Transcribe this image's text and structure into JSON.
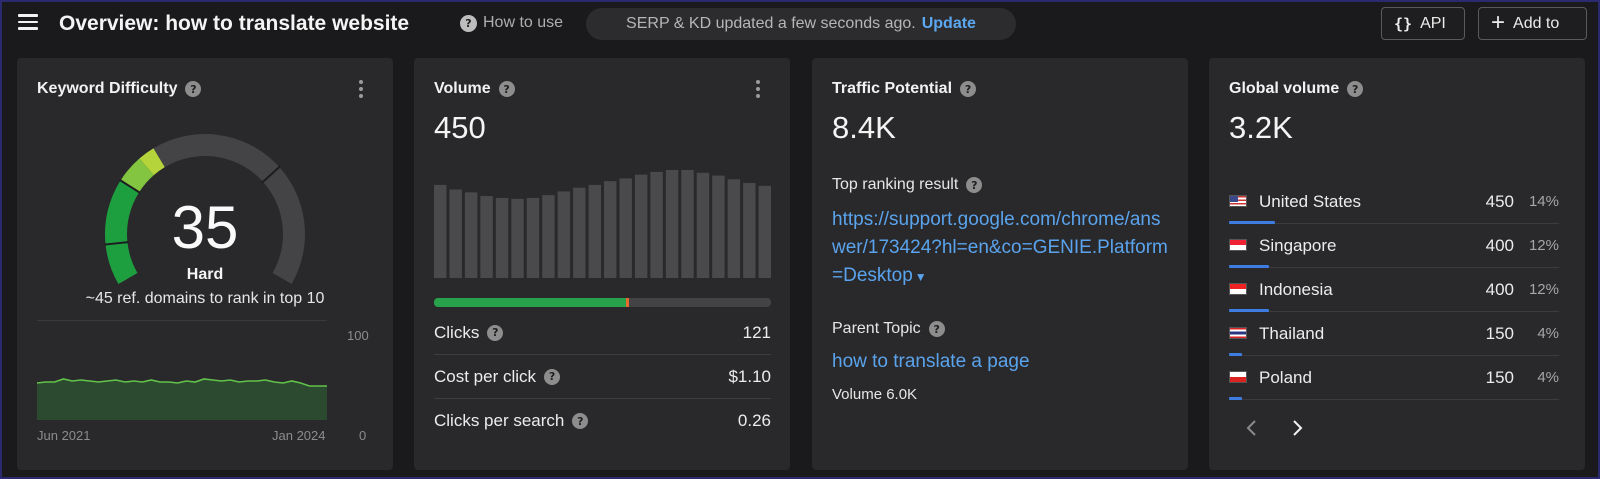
{
  "header": {
    "title": "Overview: how to translate website",
    "how_to_use": "How to use",
    "serp_status": "SERP & KD updated a few seconds ago.",
    "update_label": "Update",
    "api_icon": "{}",
    "api_label": "API",
    "add_label": "Add to"
  },
  "kd": {
    "title": "Keyword Difficulty",
    "value": 35,
    "value_text": "35",
    "level": "Hard",
    "note": "~45 ref. domains to rank in top 10",
    "chart": {
      "type": "area",
      "x_start": "Jun 2021",
      "x_end": "Jan 2024",
      "y_max": "100",
      "y_min": "0",
      "values": [
        37,
        38,
        38,
        41,
        39,
        40,
        39,
        38,
        39,
        40,
        38,
        39,
        38,
        40,
        38,
        38,
        37,
        39,
        38,
        41,
        40,
        39,
        40,
        38,
        39,
        39,
        40,
        38,
        37,
        39,
        37,
        34,
        34,
        34
      ]
    },
    "colors": {
      "easy": "#1e9f3f",
      "medium": "#83c440",
      "marker": "#b5d33a",
      "track": "#444446"
    }
  },
  "volume": {
    "title": "Volume",
    "value": "450",
    "bars": [
      100,
      95,
      92,
      88,
      86,
      85,
      86,
      89,
      93,
      97,
      100,
      104,
      107,
      111,
      114,
      116,
      116,
      113,
      110,
      106,
      102,
      99
    ],
    "clicks_share": 0.57,
    "metrics": [
      {
        "label": "Clicks",
        "value": "121"
      },
      {
        "label": "Cost per click",
        "value": "$1.10"
      },
      {
        "label": "Clicks per search",
        "value": "0.26"
      }
    ]
  },
  "traffic": {
    "title": "Traffic Potential",
    "value": "8.4K",
    "top_ranking_label": "Top ranking result",
    "top_ranking_url": "https://support.google.com/chrome/answer/173424?hl=en&co=GENIE.Platform=Desktop",
    "parent_topic_label": "Parent Topic",
    "parent_topic": "how to translate a page",
    "parent_volume": "Volume 6.0K"
  },
  "global": {
    "title": "Global volume",
    "value": "3.2K",
    "countries": [
      {
        "name": "United States",
        "volume": "450",
        "pct": "14%",
        "share": 0.14,
        "flag": "us-flag"
      },
      {
        "name": "Singapore",
        "volume": "400",
        "pct": "12%",
        "share": 0.12,
        "flag": "sg-flag"
      },
      {
        "name": "Indonesia",
        "volume": "400",
        "pct": "12%",
        "share": 0.12,
        "flag": "id-flag"
      },
      {
        "name": "Thailand",
        "volume": "150",
        "pct": "4%",
        "share": 0.04,
        "flag": "th-flag"
      },
      {
        "name": "Poland",
        "volume": "150",
        "pct": "4%",
        "share": 0.04,
        "flag": "pl-flag"
      }
    ]
  }
}
